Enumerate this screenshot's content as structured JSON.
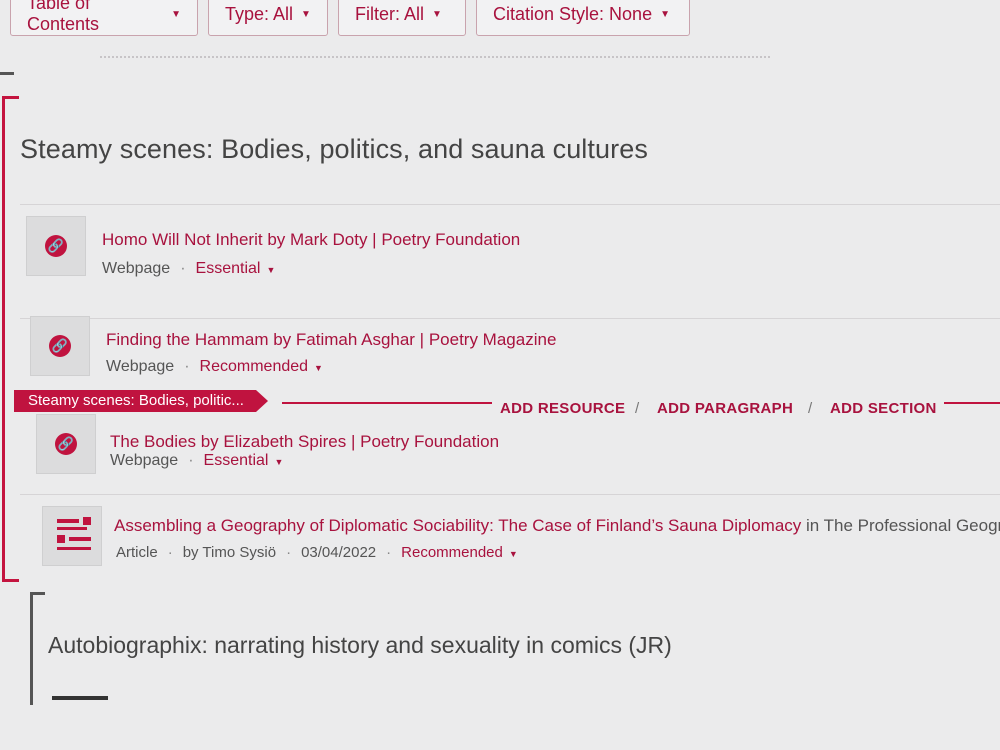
{
  "toolbar": {
    "toc": "Table of Contents",
    "type": "Type: All",
    "filter": "Filter: All",
    "citation": "Citation Style: None"
  },
  "section1": {
    "title": "Steamy scenes: Bodies, politics, and sauna cultures",
    "resources": [
      {
        "title": "Homo Will Not Inherit by Mark Doty | Poetry Foundation",
        "type": "Webpage",
        "level": "Essential"
      },
      {
        "title": "Finding the Hammam by Fatimah Asghar | Poetry Magazine",
        "type": "Webpage",
        "level": "Recommended"
      },
      {
        "title": "The Bodies by Elizabeth Spires | Poetry Foundation",
        "type": "Webpage",
        "level": "Essential"
      },
      {
        "title": "Assembling a Geography of Diplomatic Sociability: The Case of Finland’s Sauna Diplomacy",
        "source": "in The Professional Geograp",
        "type": "Article",
        "author": "by Timo Sysiö",
        "date": "03/04/2022",
        "level": "Recommended"
      }
    ]
  },
  "insert_bar": {
    "tab_label": "Steamy scenes: Bodies, politic...",
    "add_resource": "ADD RESOURCE",
    "add_paragraph": "ADD PARAGRAPH",
    "add_section": "ADD SECTION",
    "sep": "/"
  },
  "section2": {
    "title": "Autobiographix: narrating history and sexuality in comics (JR)"
  },
  "colors": {
    "accent": "#c0133f",
    "link": "#a8123e",
    "background": "#ebebec"
  }
}
